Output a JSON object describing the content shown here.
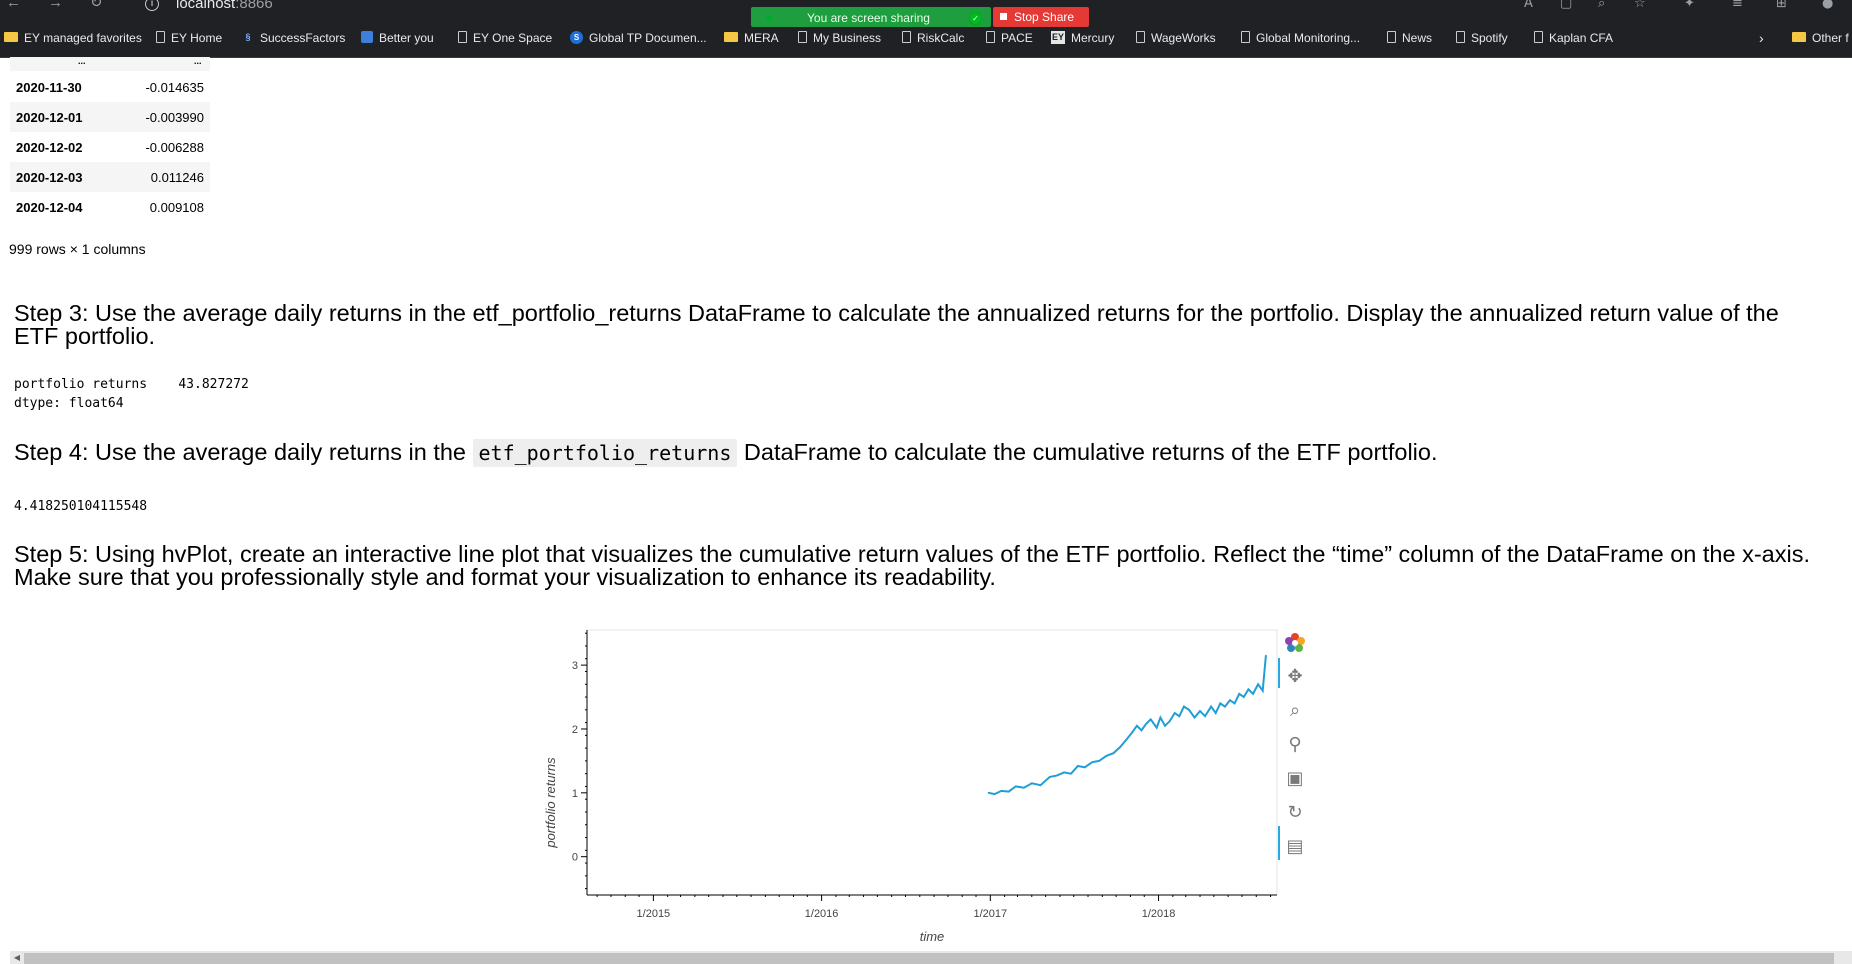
{
  "browser": {
    "url_host": "localhost",
    "url_port": ":8866",
    "screen_share": {
      "status_text": "You are screen sharing",
      "stop_label": "Stop Share"
    },
    "bookmarks": [
      {
        "label": "EY managed favorites",
        "icon": "folder-icon"
      },
      {
        "label": "EY Home",
        "icon": "page-icon"
      },
      {
        "label": "SuccessFactors",
        "icon": "successfactors-icon"
      },
      {
        "label": "Better you",
        "icon": "better-you-icon"
      },
      {
        "label": "EY One Space",
        "icon": "page-icon"
      },
      {
        "label": "Global TP Documen...",
        "icon": "sharepoint-icon"
      },
      {
        "label": "MERA",
        "icon": "folder-icon"
      },
      {
        "label": "My Business",
        "icon": "page-icon"
      },
      {
        "label": "RiskCalc",
        "icon": "page-icon"
      },
      {
        "label": "PACE",
        "icon": "page-icon"
      },
      {
        "label": "Mercury",
        "icon": "ey-icon"
      },
      {
        "label": "WageWorks",
        "icon": "page-icon"
      },
      {
        "label": "Global Monitoring...",
        "icon": "page-icon"
      },
      {
        "label": "News",
        "icon": "page-icon"
      },
      {
        "label": "Spotify",
        "icon": "page-icon"
      },
      {
        "label": "Kaplan CFA",
        "icon": "page-icon"
      }
    ],
    "other_favorites_label": "Other f"
  },
  "dataframe": {
    "ellipsis": "...",
    "rows": [
      {
        "index": "2020-11-30",
        "value": "-0.014635"
      },
      {
        "index": "2020-12-01",
        "value": "-0.003990"
      },
      {
        "index": "2020-12-02",
        "value": "-0.006288"
      },
      {
        "index": "2020-12-03",
        "value": "0.011246"
      },
      {
        "index": "2020-12-04",
        "value": "0.009108"
      }
    ],
    "shape_text": "999 rows × 1 columns"
  },
  "step3": {
    "text": "Step 3: Use the average daily returns in the etf_portfolio_returns DataFrame to calculate the annualized returns for the portfolio. Display the annualized return value of the ETF portfolio.",
    "output_line1": "portfolio returns    43.827272",
    "output_line2": "dtype: float64"
  },
  "step4": {
    "text_before": "Step 4: Use the average daily returns in the ",
    "code": "etf_portfolio_returns",
    "text_after": " DataFrame to calculate the cumulative returns of the ETF portfolio.",
    "output": "4.418250104115548"
  },
  "step5": {
    "text": "Step 5: Using hvPlot, create an interactive line plot that visualizes the cumulative return values of the ETF portfolio. Reflect the “time” column of the DataFrame on the x-axis. Make sure that you professionally style and format your visualization to enhance its readability."
  },
  "chart_data": {
    "type": "line",
    "xlabel": "time",
    "ylabel": "portfolio returns",
    "x_tick_labels": [
      "1/2015",
      "1/2016",
      "1/2017",
      "1/2018"
    ],
    "y_ticks": [
      0,
      1,
      2,
      3
    ],
    "xlim": [
      "2014-08-10",
      "2018-09-15"
    ],
    "ylim": [
      -0.6,
      3.55
    ],
    "line_color": "#1f9fd8",
    "grid": false,
    "legend": "none",
    "series": [
      {
        "x": [
          "2016-12-28",
          "2017-01-10",
          "2017-01-25",
          "2017-02-10",
          "2017-02-25",
          "2017-03-15",
          "2017-04-01",
          "2017-04-20",
          "2017-05-10",
          "2017-05-25",
          "2017-06-10",
          "2017-06-25",
          "2017-07-10",
          "2017-07-25",
          "2017-08-10",
          "2017-08-25",
          "2017-09-10",
          "2017-09-25",
          "2017-10-10",
          "2017-10-25",
          "2017-11-05",
          "2017-11-15",
          "2017-11-25",
          "2017-12-05",
          "2017-12-15",
          "2017-12-28",
          "2018-01-05",
          "2018-01-15",
          "2018-01-25",
          "2018-02-05",
          "2018-02-15",
          "2018-02-25",
          "2018-03-08",
          "2018-03-20",
          "2018-04-01",
          "2018-04-12",
          "2018-04-25",
          "2018-05-05",
          "2018-05-15",
          "2018-05-25",
          "2018-06-05",
          "2018-06-15",
          "2018-06-25",
          "2018-07-05",
          "2018-07-15",
          "2018-07-25",
          "2018-08-05",
          "2018-08-15",
          "2018-08-22"
        ],
        "values": [
          1.0,
          0.98,
          1.03,
          1.02,
          1.1,
          1.08,
          1.15,
          1.12,
          1.25,
          1.27,
          1.32,
          1.3,
          1.42,
          1.4,
          1.48,
          1.5,
          1.58,
          1.62,
          1.72,
          1.85,
          1.95,
          2.05,
          1.98,
          2.08,
          2.15,
          2.02,
          2.18,
          2.05,
          2.12,
          2.25,
          2.2,
          2.35,
          2.3,
          2.18,
          2.28,
          2.2,
          2.35,
          2.25,
          2.4,
          2.35,
          2.45,
          2.4,
          2.55,
          2.5,
          2.62,
          2.55,
          2.7,
          2.6,
          3.15
        ]
      }
    ]
  }
}
